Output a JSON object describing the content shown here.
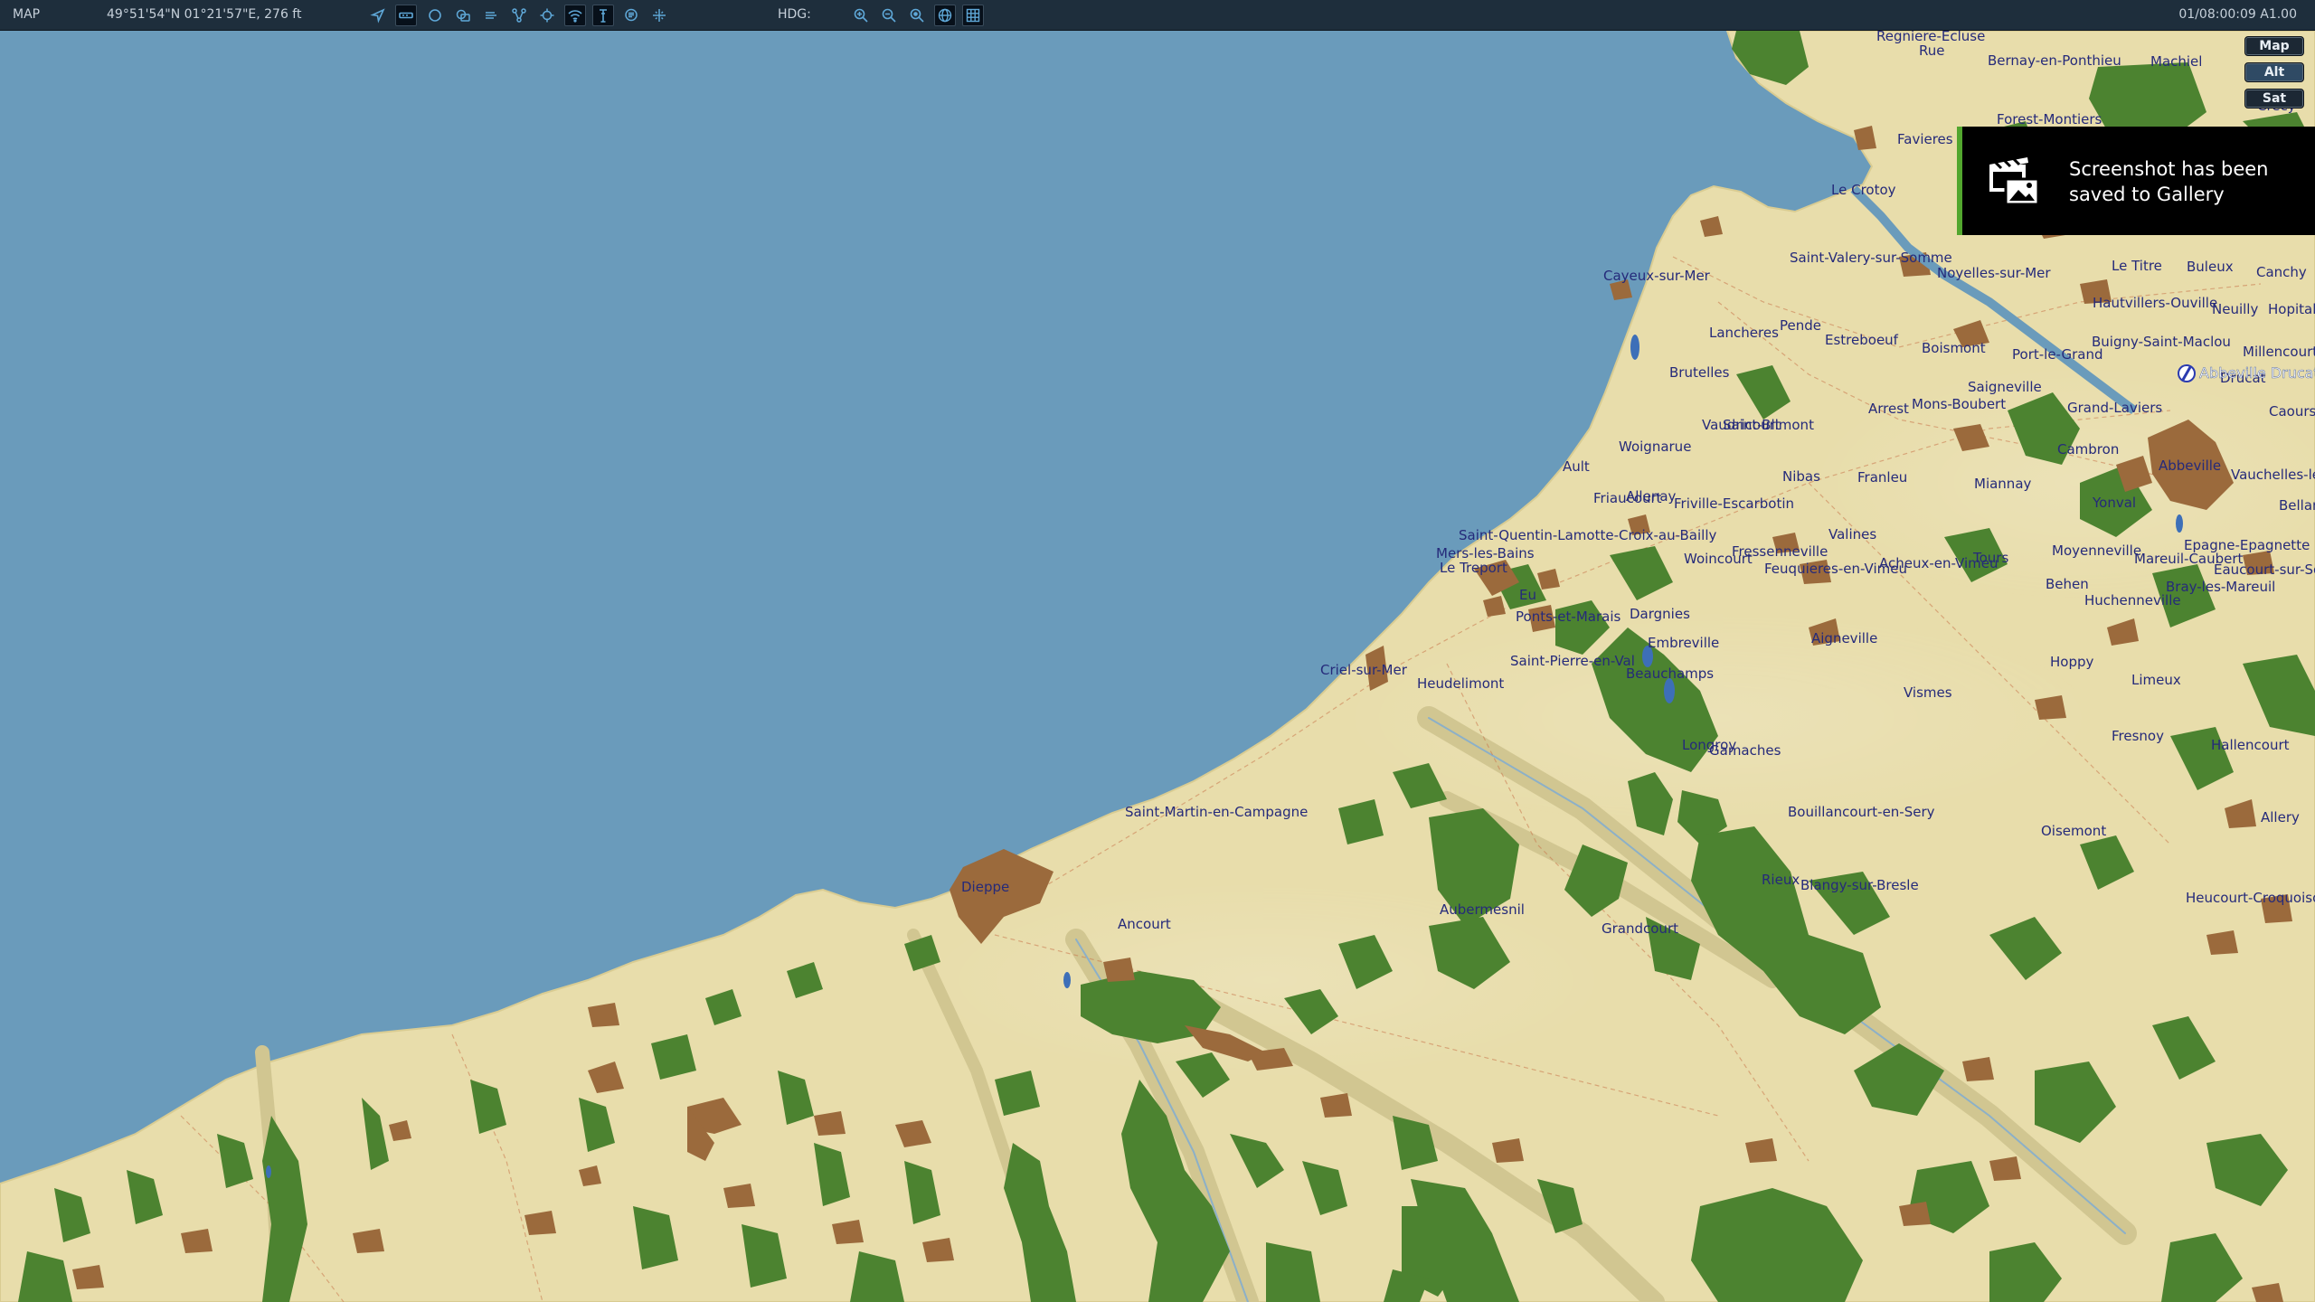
{
  "topbar": {
    "mode_label": "MAP",
    "coordinates": "49°51'54\"N 01°21'57\"E, 276 ft",
    "heading_label": "HDG:",
    "timestamp": "01/08:00:09 A1.00",
    "tool_icons": [
      "locate-icon",
      "runway-icon",
      "circle-icon",
      "layers-icon",
      "wind-icon",
      "route-icon",
      "target-icon",
      "wifi-icon",
      "tower-icon",
      "chat-icon",
      "traffic-icon"
    ],
    "zoom_icons": [
      "zoom-in-icon",
      "zoom-out-icon",
      "zoom-reset-icon",
      "globe-icon",
      "grid-icon"
    ]
  },
  "map_types": {
    "map": "Map",
    "alt": "Alt",
    "sat": "Sat",
    "active": "alt"
  },
  "toast": {
    "message": "Screenshot has been saved to Gallery",
    "icon": "clapperboard-gallery-icon"
  },
  "marker": {
    "label": "Abbeville Drucat",
    "icon": "airport-icon"
  },
  "colors": {
    "sea": "#6a9bbb",
    "land": "#e8ddab",
    "forest": "#4c8330",
    "town": "#9b6a3c",
    "label": "#252a7a",
    "toast_accent": "#52a62e"
  },
  "places": [
    {
      "name": "Regniere-Ecluse"
    },
    {
      "name": "Rue"
    },
    {
      "name": "Bernay-en-Ponthieu"
    },
    {
      "name": "Machiel"
    },
    {
      "name": "Crecy"
    },
    {
      "name": "Forest-Montiers"
    },
    {
      "name": "Favieres"
    },
    {
      "name": "Le Crotoy"
    },
    {
      "name": "Cayeux-sur-Mer"
    },
    {
      "name": "Saint-Valery-sur-Somme"
    },
    {
      "name": "Noyelles-sur-Mer"
    },
    {
      "name": "Le Titre"
    },
    {
      "name": "Buleux"
    },
    {
      "name": "Canchy"
    },
    {
      "name": "Hautvillers-Ouville"
    },
    {
      "name": "Neuilly"
    },
    {
      "name": "Hopital"
    },
    {
      "name": "Lancheres"
    },
    {
      "name": "Pende"
    },
    {
      "name": "Estreboeuf"
    },
    {
      "name": "Boismont"
    },
    {
      "name": "Port-le-Grand"
    },
    {
      "name": "Buigny-Saint-Maclou"
    },
    {
      "name": "Millencourt-en"
    },
    {
      "name": "Brutelles"
    },
    {
      "name": "Saigneville"
    },
    {
      "name": "Drucat"
    },
    {
      "name": "Caours"
    },
    {
      "name": "Arrest"
    },
    {
      "name": "Mons-Boubert"
    },
    {
      "name": "Grand-Laviers"
    },
    {
      "name": "Vaudricourt"
    },
    {
      "name": "Saint-Blimont"
    },
    {
      "name": "Woignarue"
    },
    {
      "name": "Cambron"
    },
    {
      "name": "Abbeville"
    },
    {
      "name": "Vauchelles-les-Q"
    },
    {
      "name": "Ault"
    },
    {
      "name": "Nibas"
    },
    {
      "name": "Franleu"
    },
    {
      "name": "Friaucourt"
    },
    {
      "name": "Allenay"
    },
    {
      "name": "Friville-Escarbotin"
    },
    {
      "name": "Miannay"
    },
    {
      "name": "Yonval"
    },
    {
      "name": "Bellan"
    },
    {
      "name": "Saint-Quentin-Lamotte-Croix-au-Bailly"
    },
    {
      "name": "Valines"
    },
    {
      "name": "Mers-les-Bains"
    },
    {
      "name": "Fressenneville"
    },
    {
      "name": "Moyenneville"
    },
    {
      "name": "Epagne-Epagnette"
    },
    {
      "name": "Le Treport"
    },
    {
      "name": "Woincourt"
    },
    {
      "name": "Feuquieres-en-Vimeu"
    },
    {
      "name": "Acheux-en-Vimeu"
    },
    {
      "name": "Tours"
    },
    {
      "name": "Mareuil-Caubert"
    },
    {
      "name": "Eaucourt-sur-Somme"
    },
    {
      "name": "Eu"
    },
    {
      "name": "Bray-les-Mareuil"
    },
    {
      "name": "Behen"
    },
    {
      "name": "Huchenneville"
    },
    {
      "name": "Ponts-et-Marais"
    },
    {
      "name": "Dargnies"
    },
    {
      "name": "Aigneville"
    },
    {
      "name": "Embreville"
    },
    {
      "name": "Saint-Pierre-en-Val"
    },
    {
      "name": "Hoppy"
    },
    {
      "name": "Beauchamps"
    },
    {
      "name": "Limeux"
    },
    {
      "name": "Criel-sur-Mer"
    },
    {
      "name": "Heudelimont"
    },
    {
      "name": "Vismes"
    },
    {
      "name": "Fresnoy"
    },
    {
      "name": "Longroy"
    },
    {
      "name": "Gamaches"
    },
    {
      "name": "Hallencourt"
    },
    {
      "name": "Saint-Martin-en-Campagne"
    },
    {
      "name": "Bouillancourt-en-Sery"
    },
    {
      "name": "Allery"
    },
    {
      "name": "Oisemont"
    },
    {
      "name": "Dieppe"
    },
    {
      "name": "Rieux"
    },
    {
      "name": "Blangy-sur-Bresle"
    },
    {
      "name": "Heucourt-Croquoison"
    },
    {
      "name": "Ancourt"
    },
    {
      "name": "Aubermesnil"
    },
    {
      "name": "Grandcourt"
    }
  ]
}
